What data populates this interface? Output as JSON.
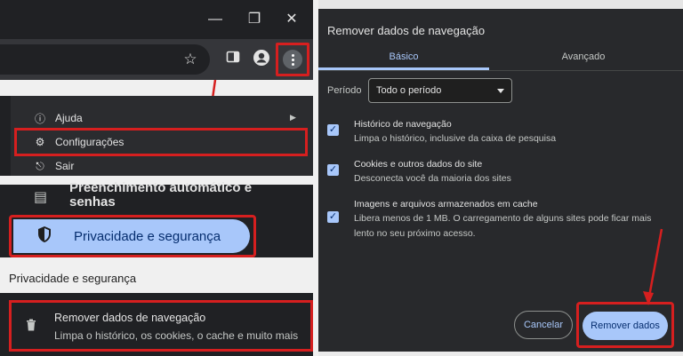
{
  "browser": {
    "window_controls": {
      "minimize": "—",
      "restore": "❐",
      "close": "✕"
    },
    "toolbar": {
      "bookmark_icon": "star-icon",
      "sidepanel_icon": "side-panel-icon",
      "profile_icon": "profile-icon",
      "menu_icon": "three-dot-menu-icon"
    }
  },
  "menu": {
    "items": [
      {
        "label": "Ajuda",
        "icon": "help-icon"
      },
      {
        "label": "Configurações",
        "icon": "gear-icon"
      },
      {
        "label": "Sair",
        "icon": "exit-icon"
      }
    ]
  },
  "settings": {
    "autofill_label": "Preenchimento automático e senhas",
    "privacy_label": "Privacidade e segurança",
    "section_title": "Privacidade e segurança",
    "remove_row": {
      "title": "Remover dados de navegação",
      "subtitle": "Limpa o histórico, os cookies, o cache e muito mais"
    }
  },
  "dialog": {
    "title": "Remover dados de navegação",
    "tabs": [
      "Básico",
      "Avançado"
    ],
    "period_label": "Período",
    "period_value": "Todo o período",
    "options": [
      {
        "title": "Histórico de navegação",
        "subtitle": "Limpa o histórico, inclusive da caixa de pesquisa",
        "checked": true
      },
      {
        "title": "Cookies e outros dados do site",
        "subtitle": "Desconecta você da maioria dos sites",
        "checked": true
      },
      {
        "title": "Imagens e arquivos armazenados em cache",
        "subtitle": "Libera menos de 1 MB. O carregamento de alguns sites pode ficar mais lento no seu próximo acesso.",
        "checked": true
      }
    ],
    "cancel_label": "Cancelar",
    "remove_label": "Remover dados"
  },
  "colors": {
    "highlight": "#d61f1f",
    "accent": "#a8c7fa",
    "background": "#202124"
  }
}
